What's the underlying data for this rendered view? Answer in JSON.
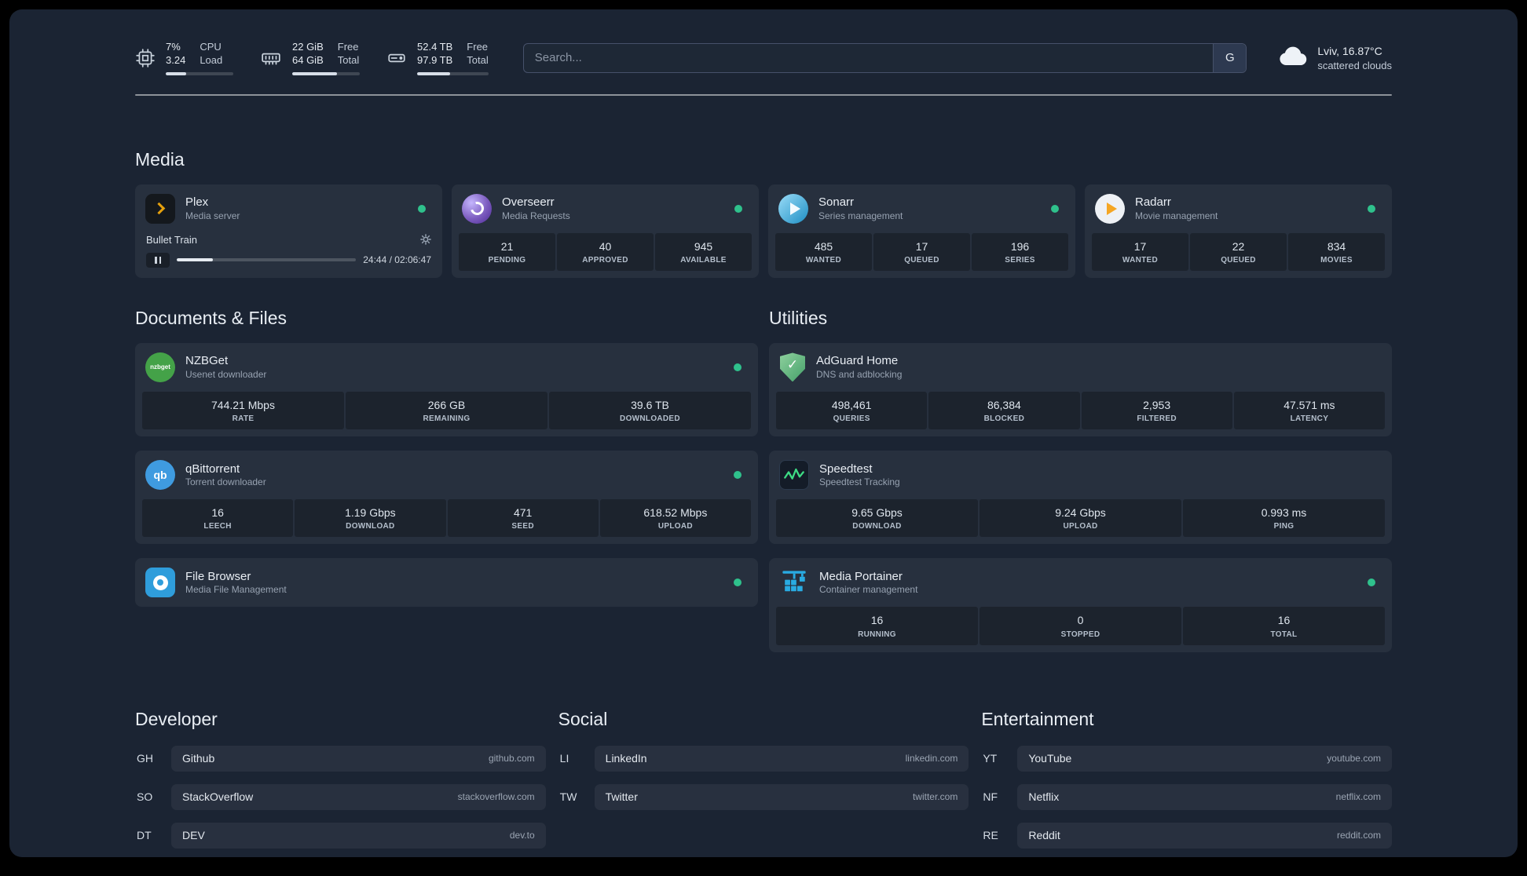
{
  "icons": {
    "check": "✓"
  },
  "header": {
    "resources": [
      {
        "name": "cpu",
        "col1": [
          "7%",
          "3.24"
        ],
        "col2": [
          "CPU",
          "Load"
        ],
        "progress": 30
      },
      {
        "name": "memory",
        "col1": [
          "22 GiB",
          "64 GiB"
        ],
        "col2": [
          "Free",
          "Total"
        ],
        "progress": 66
      },
      {
        "name": "disk",
        "col1": [
          "52.4 TB",
          "97.9 TB"
        ],
        "col2": [
          "Free",
          "Total"
        ],
        "progress": 46
      }
    ],
    "search": {
      "placeholder": "Search...",
      "button_label": "G"
    },
    "weather": {
      "location": "Lviv, 16.87°C",
      "condition": "scattered clouds"
    }
  },
  "sections": {
    "media": {
      "title": "Media",
      "plex": {
        "name": "Plex",
        "subtitle": "Media server",
        "now_playing": {
          "title": "Bullet Train",
          "time": "24:44 / 02:06:47",
          "progress": 20
        }
      },
      "overseerr": {
        "name": "Overseerr",
        "subtitle": "Media Requests",
        "stats": [
          {
            "value": "21",
            "label": "PENDING"
          },
          {
            "value": "40",
            "label": "APPROVED"
          },
          {
            "value": "945",
            "label": "AVAILABLE"
          }
        ]
      },
      "sonarr": {
        "name": "Sonarr",
        "subtitle": "Series management",
        "stats": [
          {
            "value": "485",
            "label": "WANTED"
          },
          {
            "value": "17",
            "label": "QUEUED"
          },
          {
            "value": "196",
            "label": "SERIES"
          }
        ]
      },
      "radarr": {
        "name": "Radarr",
        "subtitle": "Movie management",
        "stats": [
          {
            "value": "17",
            "label": "WANTED"
          },
          {
            "value": "22",
            "label": "QUEUED"
          },
          {
            "value": "834",
            "label": "MOVIES"
          }
        ]
      }
    },
    "documents": {
      "title": "Documents & Files",
      "nzbget": {
        "name": "NZBGet",
        "subtitle": "Usenet downloader",
        "stats": [
          {
            "value": "744.21 Mbps",
            "label": "RATE"
          },
          {
            "value": "266 GB",
            "label": "REMAINING"
          },
          {
            "value": "39.6 TB",
            "label": "DOWNLOADED"
          }
        ]
      },
      "qbittorrent": {
        "name": "qBittorrent",
        "subtitle": "Torrent downloader",
        "stats": [
          {
            "value": "16",
            "label": "LEECH"
          },
          {
            "value": "1.19 Gbps",
            "label": "DOWNLOAD"
          },
          {
            "value": "471",
            "label": "SEED"
          },
          {
            "value": "618.52 Mbps",
            "label": "UPLOAD"
          }
        ]
      },
      "filebrowser": {
        "name": "File Browser",
        "subtitle": "Media File Management"
      }
    },
    "utilities": {
      "title": "Utilities",
      "adguard": {
        "name": "AdGuard Home",
        "subtitle": "DNS and adblocking",
        "stats": [
          {
            "value": "498,461",
            "label": "QUERIES"
          },
          {
            "value": "86,384",
            "label": "BLOCKED"
          },
          {
            "value": "2,953",
            "label": "FILTERED"
          },
          {
            "value": "47.571 ms",
            "label": "LATENCY"
          }
        ]
      },
      "speedtest": {
        "name": "Speedtest",
        "subtitle": "Speedtest Tracking",
        "stats": [
          {
            "value": "9.65 Gbps",
            "label": "DOWNLOAD"
          },
          {
            "value": "9.24 Gbps",
            "label": "UPLOAD"
          },
          {
            "value": "0.993 ms",
            "label": "PING"
          }
        ]
      },
      "portainer": {
        "name": "Media Portainer",
        "subtitle": "Container management",
        "stats": [
          {
            "value": "16",
            "label": "RUNNING"
          },
          {
            "value": "0",
            "label": "STOPPED"
          },
          {
            "value": "16",
            "label": "TOTAL"
          }
        ]
      }
    },
    "bookmarks": {
      "developer": {
        "title": "Developer",
        "items": [
          {
            "abbr": "GH",
            "name": "Github",
            "url": "github.com"
          },
          {
            "abbr": "SO",
            "name": "StackOverflow",
            "url": "stackoverflow.com"
          },
          {
            "abbr": "DT",
            "name": "DEV",
            "url": "dev.to"
          }
        ]
      },
      "social": {
        "title": "Social",
        "items": [
          {
            "abbr": "LI",
            "name": "LinkedIn",
            "url": "linkedin.com"
          },
          {
            "abbr": "TW",
            "name": "Twitter",
            "url": "twitter.com"
          }
        ]
      },
      "entertainment": {
        "title": "Entertainment",
        "items": [
          {
            "abbr": "YT",
            "name": "YouTube",
            "url": "youtube.com"
          },
          {
            "abbr": "NF",
            "name": "Netflix",
            "url": "netflix.com"
          },
          {
            "abbr": "RE",
            "name": "Reddit",
            "url": "reddit.com"
          }
        ]
      }
    }
  }
}
